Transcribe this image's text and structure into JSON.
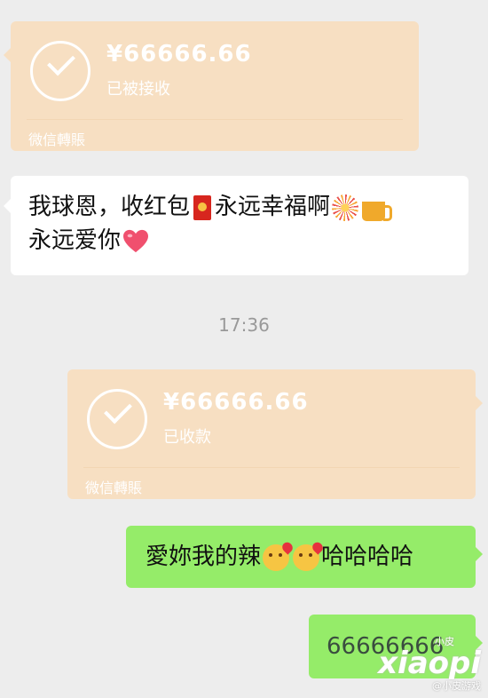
{
  "transfers": [
    {
      "amount": "¥66666.66",
      "status": "已被接收",
      "footer": "微信轉賬"
    },
    {
      "amount": "¥66666.66",
      "status": "已收款",
      "footer": "微信轉賬"
    }
  ],
  "messages": {
    "received_line1": "我球恩，收红包",
    "received_line1_b": "永远幸福啊",
    "received_line2": "永远爱你",
    "timestamp": "17:36",
    "sent_text_a": "愛妳我的辣",
    "sent_text_b": "哈哈哈哈",
    "sent_number": "66666666"
  },
  "icons": {
    "red_envelope": "red-envelope-icon",
    "fireworks": "fireworks-icon",
    "beer": "beer-icon",
    "heart": "heart-icon",
    "kiss": "kiss-face-icon",
    "check": "check-circle-icon"
  },
  "colors": {
    "chat_background": "#ededed",
    "transfer_card": "#f7dfc2",
    "sent_bubble": "#95ec69",
    "received_bubble": "#ffffff"
  },
  "watermark": {
    "logo": "xiaopi",
    "sub_top": "小皮",
    "sub_bottom": "@小皮游戏"
  }
}
